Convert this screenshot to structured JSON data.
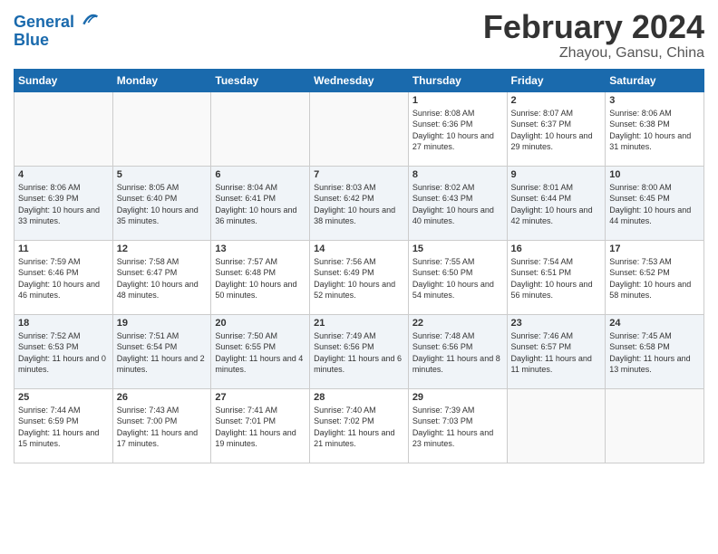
{
  "logo": {
    "line1": "General",
    "line2": "Blue"
  },
  "title": "February 2024",
  "location": "Zhayou, Gansu, China",
  "days_of_week": [
    "Sunday",
    "Monday",
    "Tuesday",
    "Wednesday",
    "Thursday",
    "Friday",
    "Saturday"
  ],
  "weeks": [
    [
      {
        "day": "",
        "info": ""
      },
      {
        "day": "",
        "info": ""
      },
      {
        "day": "",
        "info": ""
      },
      {
        "day": "",
        "info": ""
      },
      {
        "day": "1",
        "info": "Sunrise: 8:08 AM\nSunset: 6:36 PM\nDaylight: 10 hours and 27 minutes."
      },
      {
        "day": "2",
        "info": "Sunrise: 8:07 AM\nSunset: 6:37 PM\nDaylight: 10 hours and 29 minutes."
      },
      {
        "day": "3",
        "info": "Sunrise: 8:06 AM\nSunset: 6:38 PM\nDaylight: 10 hours and 31 minutes."
      }
    ],
    [
      {
        "day": "4",
        "info": "Sunrise: 8:06 AM\nSunset: 6:39 PM\nDaylight: 10 hours and 33 minutes."
      },
      {
        "day": "5",
        "info": "Sunrise: 8:05 AM\nSunset: 6:40 PM\nDaylight: 10 hours and 35 minutes."
      },
      {
        "day": "6",
        "info": "Sunrise: 8:04 AM\nSunset: 6:41 PM\nDaylight: 10 hours and 36 minutes."
      },
      {
        "day": "7",
        "info": "Sunrise: 8:03 AM\nSunset: 6:42 PM\nDaylight: 10 hours and 38 minutes."
      },
      {
        "day": "8",
        "info": "Sunrise: 8:02 AM\nSunset: 6:43 PM\nDaylight: 10 hours and 40 minutes."
      },
      {
        "day": "9",
        "info": "Sunrise: 8:01 AM\nSunset: 6:44 PM\nDaylight: 10 hours and 42 minutes."
      },
      {
        "day": "10",
        "info": "Sunrise: 8:00 AM\nSunset: 6:45 PM\nDaylight: 10 hours and 44 minutes."
      }
    ],
    [
      {
        "day": "11",
        "info": "Sunrise: 7:59 AM\nSunset: 6:46 PM\nDaylight: 10 hours and 46 minutes."
      },
      {
        "day": "12",
        "info": "Sunrise: 7:58 AM\nSunset: 6:47 PM\nDaylight: 10 hours and 48 minutes."
      },
      {
        "day": "13",
        "info": "Sunrise: 7:57 AM\nSunset: 6:48 PM\nDaylight: 10 hours and 50 minutes."
      },
      {
        "day": "14",
        "info": "Sunrise: 7:56 AM\nSunset: 6:49 PM\nDaylight: 10 hours and 52 minutes."
      },
      {
        "day": "15",
        "info": "Sunrise: 7:55 AM\nSunset: 6:50 PM\nDaylight: 10 hours and 54 minutes."
      },
      {
        "day": "16",
        "info": "Sunrise: 7:54 AM\nSunset: 6:51 PM\nDaylight: 10 hours and 56 minutes."
      },
      {
        "day": "17",
        "info": "Sunrise: 7:53 AM\nSunset: 6:52 PM\nDaylight: 10 hours and 58 minutes."
      }
    ],
    [
      {
        "day": "18",
        "info": "Sunrise: 7:52 AM\nSunset: 6:53 PM\nDaylight: 11 hours and 0 minutes."
      },
      {
        "day": "19",
        "info": "Sunrise: 7:51 AM\nSunset: 6:54 PM\nDaylight: 11 hours and 2 minutes."
      },
      {
        "day": "20",
        "info": "Sunrise: 7:50 AM\nSunset: 6:55 PM\nDaylight: 11 hours and 4 minutes."
      },
      {
        "day": "21",
        "info": "Sunrise: 7:49 AM\nSunset: 6:56 PM\nDaylight: 11 hours and 6 minutes."
      },
      {
        "day": "22",
        "info": "Sunrise: 7:48 AM\nSunset: 6:56 PM\nDaylight: 11 hours and 8 minutes."
      },
      {
        "day": "23",
        "info": "Sunrise: 7:46 AM\nSunset: 6:57 PM\nDaylight: 11 hours and 11 minutes."
      },
      {
        "day": "24",
        "info": "Sunrise: 7:45 AM\nSunset: 6:58 PM\nDaylight: 11 hours and 13 minutes."
      }
    ],
    [
      {
        "day": "25",
        "info": "Sunrise: 7:44 AM\nSunset: 6:59 PM\nDaylight: 11 hours and 15 minutes."
      },
      {
        "day": "26",
        "info": "Sunrise: 7:43 AM\nSunset: 7:00 PM\nDaylight: 11 hours and 17 minutes."
      },
      {
        "day": "27",
        "info": "Sunrise: 7:41 AM\nSunset: 7:01 PM\nDaylight: 11 hours and 19 minutes."
      },
      {
        "day": "28",
        "info": "Sunrise: 7:40 AM\nSunset: 7:02 PM\nDaylight: 11 hours and 21 minutes."
      },
      {
        "day": "29",
        "info": "Sunrise: 7:39 AM\nSunset: 7:03 PM\nDaylight: 11 hours and 23 minutes."
      },
      {
        "day": "",
        "info": ""
      },
      {
        "day": "",
        "info": ""
      }
    ]
  ]
}
